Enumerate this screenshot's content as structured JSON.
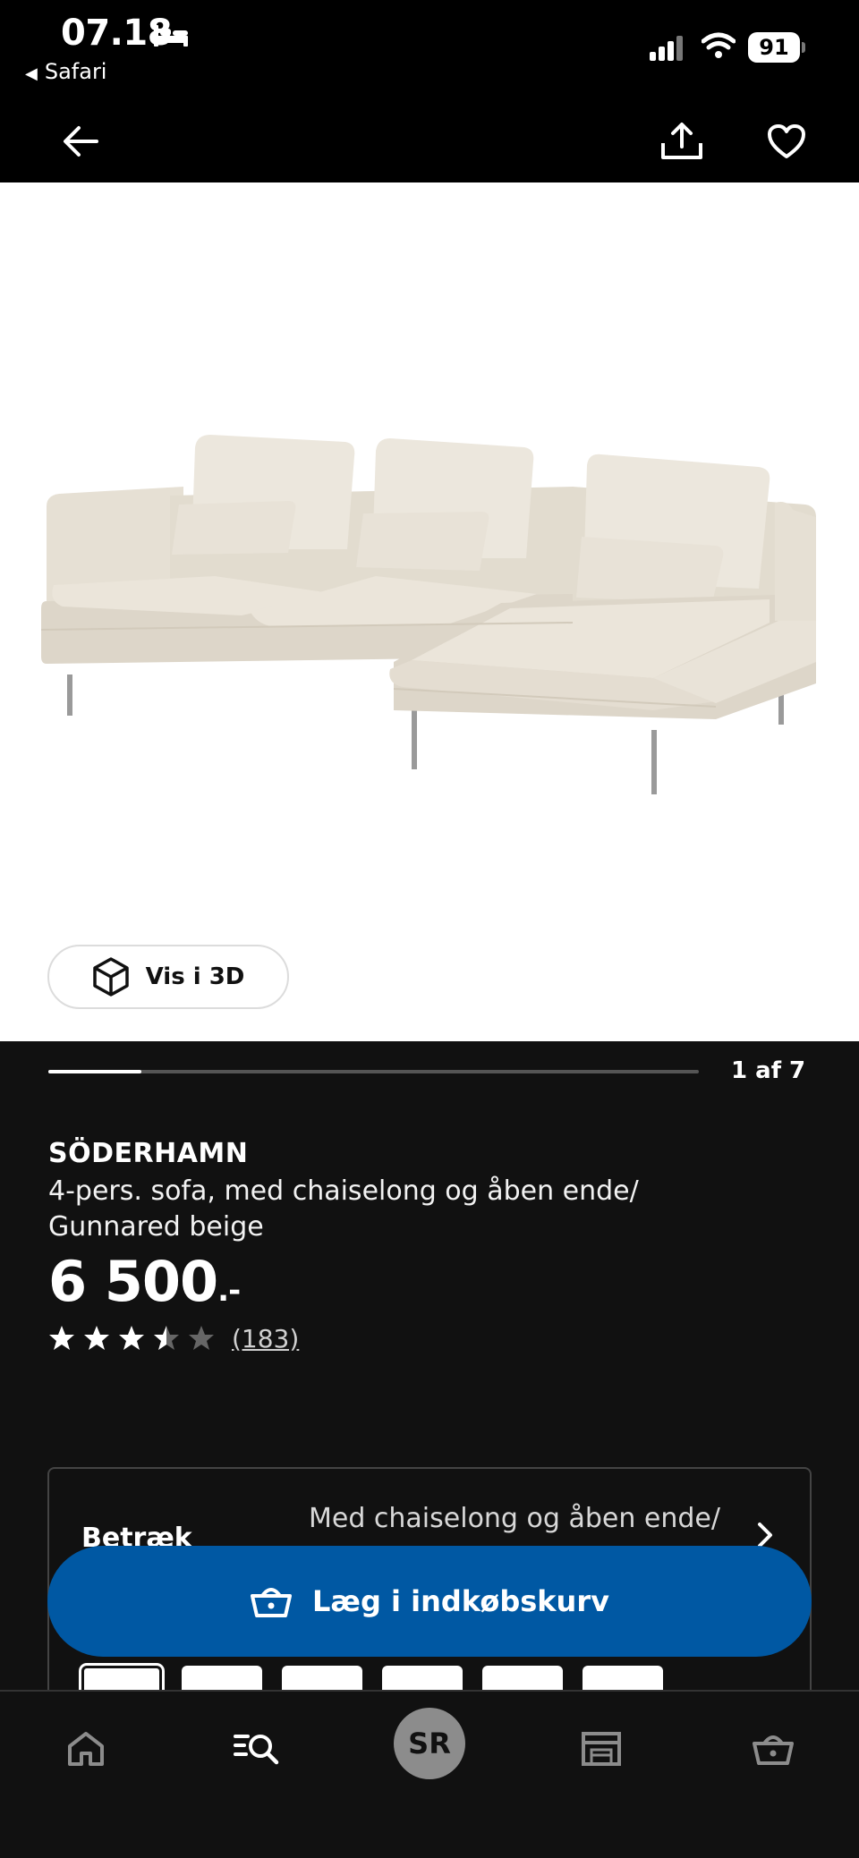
{
  "status_bar": {
    "time": "07.18",
    "back_app": "Safari",
    "battery": "91"
  },
  "nav": {
    "back_icon": "arrow-left-icon",
    "share_icon": "share-icon",
    "favorite_icon": "heart-icon"
  },
  "hero": {
    "view_3d_label": "Vis i 3D"
  },
  "gallery": {
    "counter": "1 af 7",
    "current": 1,
    "total": 7
  },
  "product": {
    "name": "SÖDERHAMN",
    "description": "4-pers. sofa, med chaiselong og åben ende/ Gunnared beige",
    "price": "6 500",
    "price_suffix": ".-",
    "rating": 3.5,
    "rating_max": 5,
    "review_count": "(183)"
  },
  "variant": {
    "label": "Betræk",
    "value": "Med chaiselong og åben ende/"
  },
  "cart": {
    "label": "Læg i indkøbskurv"
  },
  "tabs": {
    "avatar_initials": "SR",
    "items": [
      "home-icon",
      "search-icon",
      "avatar",
      "store-icon",
      "cart-icon"
    ]
  },
  "colors": {
    "accent": "#0058a3",
    "background": "#111111",
    "hero_background": "#ffffff",
    "sofa_fabric": "#e8e2d6"
  }
}
